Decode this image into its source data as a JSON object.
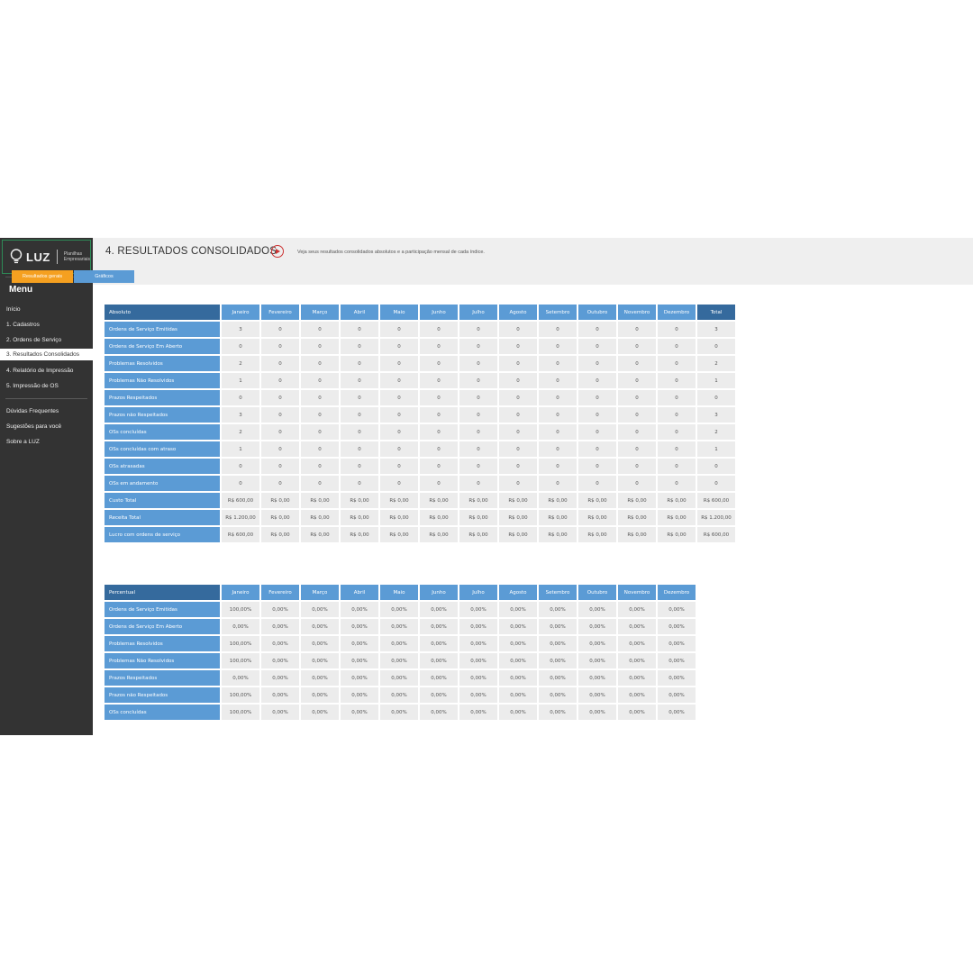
{
  "logo": {
    "brand": "LUZ",
    "subtitle_line1": "Planilhas",
    "subtitle_line2": "Empresariais"
  },
  "sidebar": {
    "menu_title": "Menu",
    "items": [
      {
        "label": "Início"
      },
      {
        "label": "1. Cadastros"
      },
      {
        "label": "2. Ordens de Serviço"
      },
      {
        "label": "3. Resultados Consolidados",
        "active": true
      },
      {
        "label": "4. Relatório de Impressão"
      },
      {
        "label": "5. Impressão de OS"
      }
    ],
    "extra_items": [
      {
        "label": "Dúvidas Frequentes"
      },
      {
        "label": "Sugestões para você"
      },
      {
        "label": "Sobre a LUZ"
      }
    ]
  },
  "header": {
    "title": "4. RESULTADOS CONSOLIDADOS",
    "description": "Veja seus resultados consolidados absolutos e a participação mensal de cada índice.",
    "tabs": [
      {
        "label": "Resultados gerais"
      },
      {
        "label": "Gráficos"
      }
    ]
  },
  "colors": {
    "sidebar_bg": "#333333",
    "header_blue": "#5b9bd5",
    "corner_blue": "#356a9d",
    "tab_orange": "#f5a020",
    "cell_bg": "#ececec",
    "play_icon": "#cc3333"
  },
  "icons": {
    "play": "play-circle-icon",
    "logo": "lightbulb-icon"
  },
  "absolute_table": {
    "corner": "Absoluto",
    "columns": [
      "Janeiro",
      "Fevereiro",
      "Março",
      "Abril",
      "Maio",
      "Junho",
      "Julho",
      "Agosto",
      "Setembro",
      "Outubro",
      "Novembro",
      "Dezembro",
      "Total"
    ],
    "rows": [
      {
        "label": "Ordens de Serviço Emitidas",
        "values": [
          "3",
          "0",
          "0",
          "0",
          "0",
          "0",
          "0",
          "0",
          "0",
          "0",
          "0",
          "0",
          "3"
        ]
      },
      {
        "label": "Ordens de Serviço Em Aberto",
        "values": [
          "0",
          "0",
          "0",
          "0",
          "0",
          "0",
          "0",
          "0",
          "0",
          "0",
          "0",
          "0",
          "0"
        ]
      },
      {
        "label": "Problemas Resolvidos",
        "values": [
          "2",
          "0",
          "0",
          "0",
          "0",
          "0",
          "0",
          "0",
          "0",
          "0",
          "0",
          "0",
          "2"
        ]
      },
      {
        "label": "Problemas Não Resolvidos",
        "values": [
          "1",
          "0",
          "0",
          "0",
          "0",
          "0",
          "0",
          "0",
          "0",
          "0",
          "0",
          "0",
          "1"
        ]
      },
      {
        "label": "Prazos Respeitados",
        "values": [
          "0",
          "0",
          "0",
          "0",
          "0",
          "0",
          "0",
          "0",
          "0",
          "0",
          "0",
          "0",
          "0"
        ]
      },
      {
        "label": "Prazos não Respeitados",
        "values": [
          "3",
          "0",
          "0",
          "0",
          "0",
          "0",
          "0",
          "0",
          "0",
          "0",
          "0",
          "0",
          "3"
        ]
      },
      {
        "label": "OSs concluídas",
        "values": [
          "2",
          "0",
          "0",
          "0",
          "0",
          "0",
          "0",
          "0",
          "0",
          "0",
          "0",
          "0",
          "2"
        ]
      },
      {
        "label": "OSs concluídas com atraso",
        "values": [
          "1",
          "0",
          "0",
          "0",
          "0",
          "0",
          "0",
          "0",
          "0",
          "0",
          "0",
          "0",
          "1"
        ]
      },
      {
        "label": "OSs atrasadas",
        "values": [
          "0",
          "0",
          "0",
          "0",
          "0",
          "0",
          "0",
          "0",
          "0",
          "0",
          "0",
          "0",
          "0"
        ]
      },
      {
        "label": "OSs em andamento",
        "values": [
          "0",
          "0",
          "0",
          "0",
          "0",
          "0",
          "0",
          "0",
          "0",
          "0",
          "0",
          "0",
          "0"
        ]
      },
      {
        "label": "Custo Total",
        "values": [
          "R$ 600,00",
          "R$ 0,00",
          "R$ 0,00",
          "R$ 0,00",
          "R$ 0,00",
          "R$ 0,00",
          "R$ 0,00",
          "R$ 0,00",
          "R$ 0,00",
          "R$ 0,00",
          "R$ 0,00",
          "R$ 0,00",
          "R$ 600,00"
        ]
      },
      {
        "label": "Receita Total",
        "values": [
          "R$ 1.200,00",
          "R$ 0,00",
          "R$ 0,00",
          "R$ 0,00",
          "R$ 0,00",
          "R$ 0,00",
          "R$ 0,00",
          "R$ 0,00",
          "R$ 0,00",
          "R$ 0,00",
          "R$ 0,00",
          "R$ 0,00",
          "R$ 1.200,00"
        ]
      },
      {
        "label": "Lucro com ordens de serviço",
        "values": [
          "R$ 600,00",
          "R$ 0,00",
          "R$ 0,00",
          "R$ 0,00",
          "R$ 0,00",
          "R$ 0,00",
          "R$ 0,00",
          "R$ 0,00",
          "R$ 0,00",
          "R$ 0,00",
          "R$ 0,00",
          "R$ 0,00",
          "R$ 600,00"
        ]
      }
    ]
  },
  "percent_table": {
    "corner": "Percentual",
    "columns": [
      "Janeiro",
      "Fevereiro",
      "Março",
      "Abril",
      "Maio",
      "Junho",
      "Julho",
      "Agosto",
      "Setembro",
      "Outubro",
      "Novembro",
      "Dezembro"
    ],
    "rows": [
      {
        "label": "Ordens de Serviço Emitidas",
        "values": [
          "100,00%",
          "0,00%",
          "0,00%",
          "0,00%",
          "0,00%",
          "0,00%",
          "0,00%",
          "0,00%",
          "0,00%",
          "0,00%",
          "0,00%",
          "0,00%"
        ]
      },
      {
        "label": "Ordens de Serviço Em Aberto",
        "values": [
          "0,00%",
          "0,00%",
          "0,00%",
          "0,00%",
          "0,00%",
          "0,00%",
          "0,00%",
          "0,00%",
          "0,00%",
          "0,00%",
          "0,00%",
          "0,00%"
        ]
      },
      {
        "label": "Problemas Resolvidos",
        "values": [
          "100,00%",
          "0,00%",
          "0,00%",
          "0,00%",
          "0,00%",
          "0,00%",
          "0,00%",
          "0,00%",
          "0,00%",
          "0,00%",
          "0,00%",
          "0,00%"
        ]
      },
      {
        "label": "Problemas Não Resolvidos",
        "values": [
          "100,00%",
          "0,00%",
          "0,00%",
          "0,00%",
          "0,00%",
          "0,00%",
          "0,00%",
          "0,00%",
          "0,00%",
          "0,00%",
          "0,00%",
          "0,00%"
        ]
      },
      {
        "label": "Prazos Respeitados",
        "values": [
          "0,00%",
          "0,00%",
          "0,00%",
          "0,00%",
          "0,00%",
          "0,00%",
          "0,00%",
          "0,00%",
          "0,00%",
          "0,00%",
          "0,00%",
          "0,00%"
        ]
      },
      {
        "label": "Prazos não Respeitados",
        "values": [
          "100,00%",
          "0,00%",
          "0,00%",
          "0,00%",
          "0,00%",
          "0,00%",
          "0,00%",
          "0,00%",
          "0,00%",
          "0,00%",
          "0,00%",
          "0,00%"
        ]
      },
      {
        "label": "OSs concluídas",
        "values": [
          "100,00%",
          "0,00%",
          "0,00%",
          "0,00%",
          "0,00%",
          "0,00%",
          "0,00%",
          "0,00%",
          "0,00%",
          "0,00%",
          "0,00%",
          "0,00%"
        ]
      }
    ]
  }
}
